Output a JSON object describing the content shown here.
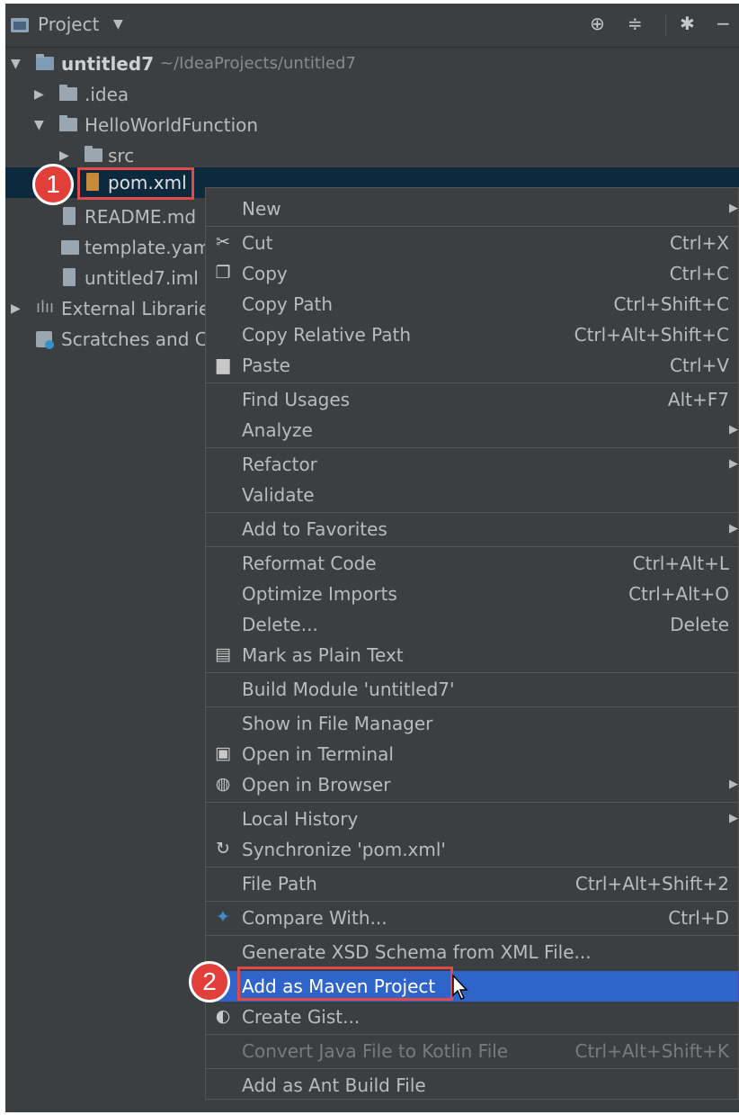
{
  "header": {
    "title": "Project",
    "tools": [
      "target-icon",
      "collapse-icon",
      "gear-icon",
      "minimize-icon"
    ]
  },
  "tree": [
    {
      "label": "untitled7",
      "path": "~/IdeaProjects/untitled7",
      "icon": "module-folder-icon",
      "expanded": true
    },
    {
      "label": ".idea",
      "icon": "folder-icon",
      "expanded": false
    },
    {
      "label": "HelloWorldFunction",
      "icon": "folder-icon",
      "expanded": true
    },
    {
      "label": "src",
      "icon": "folder-icon",
      "expanded": false
    },
    {
      "label": "pom.xml",
      "icon": "maven-file-icon",
      "selected": true
    },
    {
      "label": "README.md",
      "icon": "markdown-file-icon"
    },
    {
      "label": "template.yam",
      "icon": "yaml-file-icon"
    },
    {
      "label": "untitled7.iml",
      "icon": "iml-file-icon"
    },
    {
      "label": "External Librarie",
      "icon": "library-icon",
      "expanded": false
    },
    {
      "label": "Scratches and C",
      "icon": "scratches-icon"
    }
  ],
  "callouts": [
    "1",
    "2"
  ],
  "menu": [
    {
      "label": "New",
      "submenu": true
    },
    {
      "label": "Cut",
      "shortcut": "Ctrl+X",
      "icon": "scissors-icon",
      "mnemonic": "t"
    },
    {
      "label": "Copy",
      "shortcut": "Ctrl+C",
      "icon": "copy-icon",
      "mnemonic": "C"
    },
    {
      "label": "Copy Path",
      "shortcut": "Ctrl+Shift+C",
      "mnemonic": "o"
    },
    {
      "label": "Copy Relative Path",
      "shortcut": "Ctrl+Alt+Shift+C",
      "mnemonic": "y"
    },
    {
      "label": "Paste",
      "shortcut": "Ctrl+V",
      "icon": "paste-icon",
      "mnemonic": "P"
    },
    {
      "label": "Find Usages",
      "shortcut": "Alt+F7",
      "mnemonic": "U"
    },
    {
      "label": "Analyze",
      "submenu": true,
      "mnemonic": "z"
    },
    {
      "label": "Refactor",
      "submenu": true,
      "mnemonic": "R"
    },
    {
      "label": "Validate",
      "mnemonic": "V"
    },
    {
      "label": "Add to Favorites",
      "submenu": true,
      "mnemonic": "a"
    },
    {
      "label": "Reformat Code",
      "shortcut": "Ctrl+Alt+L",
      "mnemonic": "R"
    },
    {
      "label": "Optimize Imports",
      "shortcut": "Ctrl+Alt+O",
      "mnemonic": "z"
    },
    {
      "label": "Delete...",
      "shortcut": "Delete",
      "mnemonic": "D"
    },
    {
      "label": "Mark as Plain Text",
      "icon": "plain-text-icon"
    },
    {
      "label": "Build Module 'untitled7'",
      "mnemonic": "M"
    },
    {
      "label": "Show in File Manager"
    },
    {
      "label": "Open in Terminal",
      "icon": "terminal-icon"
    },
    {
      "label": "Open in Browser",
      "submenu": true,
      "icon": "globe-icon",
      "mnemonic": "B"
    },
    {
      "label": "Local History",
      "submenu": true,
      "mnemonic": "H"
    },
    {
      "label": "Synchronize 'pom.xml'",
      "icon": "sync-icon"
    },
    {
      "label": "File Path",
      "shortcut": "Ctrl+Alt+Shift+2",
      "mnemonic": "P"
    },
    {
      "label": "Compare With...",
      "shortcut": "Ctrl+D",
      "icon": "compare-icon"
    },
    {
      "label": "Generate XSD Schema from XML File..."
    },
    {
      "label": "Add as Maven Project",
      "highlighted": true
    },
    {
      "label": "Create Gist...",
      "icon": "github-icon"
    },
    {
      "label": "Convert Java File to Kotlin File",
      "shortcut": "Ctrl+Alt+Shift+K",
      "disabled": true
    },
    {
      "label": "Add as Ant Build File",
      "mnemonic": "n"
    }
  ],
  "colors": {
    "background": "#3c3f41",
    "selection": "#0d293e",
    "highlight": "#2f65ca",
    "callout": "#e23f3a",
    "text": "#bbbbbb"
  }
}
